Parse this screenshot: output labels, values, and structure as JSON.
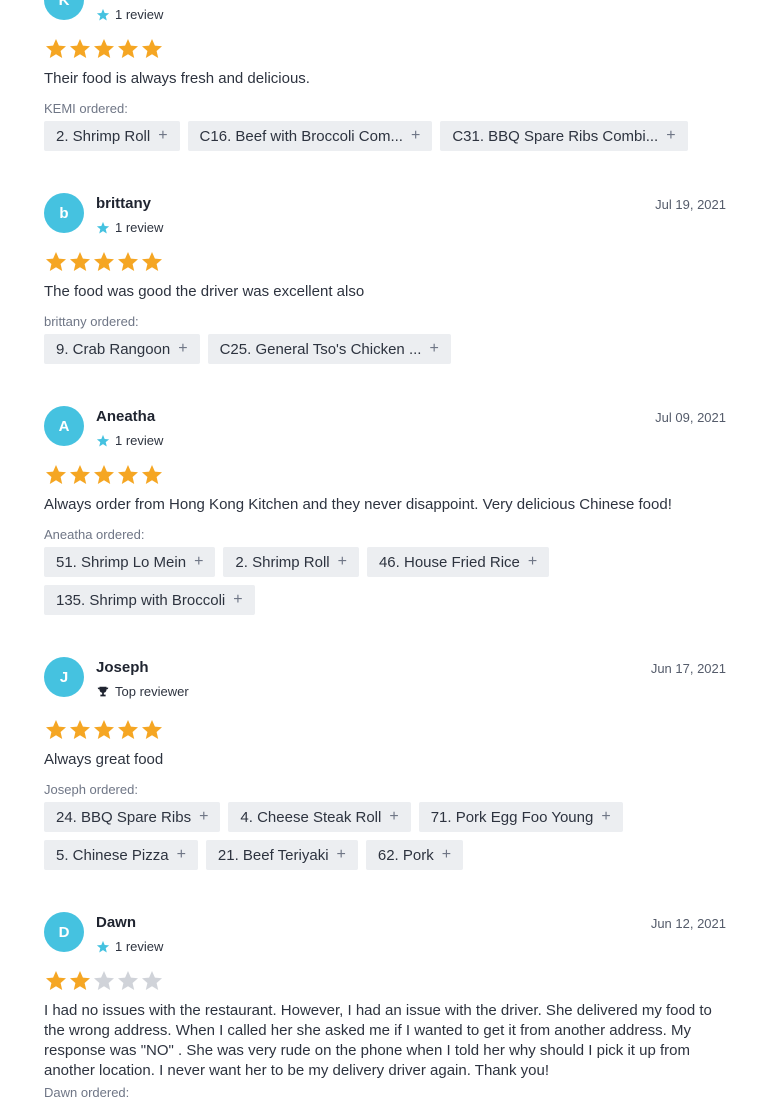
{
  "colors": {
    "star_filled": "#f5a623",
    "star_empty": "#d0d3d9",
    "avatar": "#45c2e0",
    "chip_bg": "#eceef1"
  },
  "reviews": [
    {
      "initial": "K",
      "name": "",
      "badge_icon": "star-icon",
      "badge": "1 review",
      "date": "",
      "rating": 5,
      "text": "Their food is always fresh and delicious.",
      "ordered_label": "KEMI ordered:",
      "items": [
        "2. Shrimp Roll",
        "C16. Beef with Broccoli Com...",
        "C31. BBQ Spare Ribs Combi..."
      ]
    },
    {
      "initial": "b",
      "name": "brittany",
      "badge_icon": "star-icon",
      "badge": "1 review",
      "date": "Jul 19, 2021",
      "rating": 5,
      "text": "The food was good the driver was excellent also",
      "ordered_label": "brittany ordered:",
      "items": [
        "9. Crab Rangoon",
        "C25. General Tso's Chicken ..."
      ]
    },
    {
      "initial": "A",
      "name": "Aneatha",
      "badge_icon": "star-icon",
      "badge": "1 review",
      "date": "Jul 09, 2021",
      "rating": 5,
      "text": "Always order from Hong Kong Kitchen and they never disappoint. Very delicious Chinese food!",
      "ordered_label": "Aneatha ordered:",
      "items": [
        "51. Shrimp Lo Mein",
        "2. Shrimp Roll",
        "46. House Fried Rice",
        "135. Shrimp with Broccoli"
      ]
    },
    {
      "initial": "J",
      "name": "Joseph",
      "badge_icon": "trophy-icon",
      "badge": "Top reviewer",
      "date": "Jun 17, 2021",
      "rating": 5,
      "text": "Always great food",
      "ordered_label": "Joseph ordered:",
      "items": [
        "24. BBQ Spare Ribs",
        "4. Cheese Steak Roll",
        "71. Pork Egg Foo Young",
        "5. Chinese Pizza",
        "21. Beef Teriyaki",
        "62. Pork"
      ]
    },
    {
      "initial": "D",
      "name": "Dawn",
      "badge_icon": "star-icon",
      "badge": "1 review",
      "date": "Jun 12, 2021",
      "rating": 2,
      "text": "I had no issues with the restaurant. However, I had an issue with the driver. She delivered my food to the wrong address. When I called her she asked me if I wanted to get it from another address. My response was \"NO\" . She was very rude on the phone when I told her why should I pick it up from another location. I never want her to be my delivery driver again. Thank you!",
      "ordered_label": "Dawn ordered:",
      "items": []
    }
  ]
}
